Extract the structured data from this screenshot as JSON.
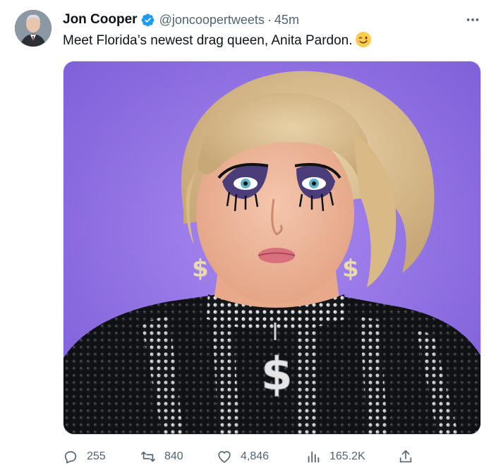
{
  "tweet": {
    "author_name": "Jon Cooper",
    "handle": "@joncoopertweets",
    "separator": "·",
    "time": "45m",
    "text": "Meet Florida’s newest drag queen, Anita Pardon.",
    "emoji": "winking-face",
    "verified_color": "#1d9bf0"
  },
  "actions": {
    "replies": "255",
    "retweets": "840",
    "likes": "4,846",
    "views": "165.2K"
  },
  "icons": {
    "more": "more-horizontal-icon",
    "reply": "reply-icon",
    "retweet": "retweet-icon",
    "like": "heart-icon",
    "views": "views-bar-chart-icon",
    "share": "share-icon"
  },
  "colors": {
    "text_primary": "#0f1419",
    "text_secondary": "#536471",
    "media_background": "#8b6fe0"
  }
}
